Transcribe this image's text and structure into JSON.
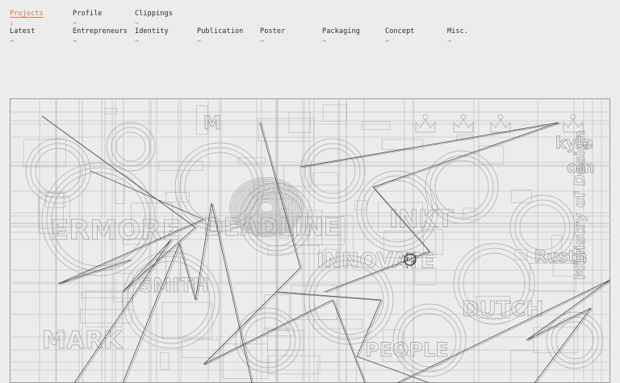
{
  "nav": {
    "primary": [
      {
        "label": "Projects",
        "arrow": "↓",
        "active": true
      },
      {
        "label": "Profile",
        "arrow": "→",
        "active": false
      },
      {
        "label": "Clippings",
        "arrow": "→",
        "active": false
      }
    ],
    "categories": [
      {
        "label": "Latest",
        "arrow": "→"
      },
      {
        "label": "Entrepreneurs",
        "arrow": "→"
      },
      {
        "label": "Identity",
        "arrow": "→"
      },
      {
        "label": "Publication",
        "arrow": "→"
      },
      {
        "label": "Poster",
        "arrow": "→"
      },
      {
        "label": "Packaging",
        "arrow": "→"
      },
      {
        "label": "Concept",
        "arrow": "→"
      },
      {
        "label": "Misc.",
        "arrow": "→"
      }
    ]
  },
  "artwork": {
    "texts": [
      "kyle",
      "om",
      "Rusth",
      "M"
    ]
  },
  "colors": {
    "accent": "#d9774b",
    "background": "#ececec",
    "line": "#8a8a8a",
    "text": "#2b2b2b"
  }
}
